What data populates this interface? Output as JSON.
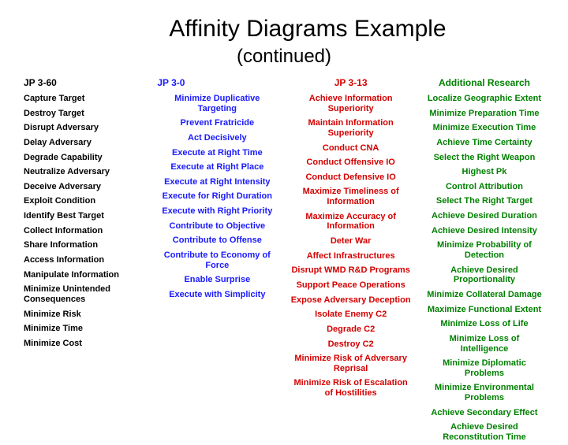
{
  "title": "Affinity Diagrams Example",
  "subtitle": "(continued)",
  "columns": [
    {
      "header": "JP 3-60",
      "color": "#000000",
      "items": [
        "Capture Target",
        "Destroy Target",
        "Disrupt Adversary",
        "Delay Adversary",
        "Degrade Capability",
        "Neutralize Adversary",
        "Deceive Adversary",
        "Exploit Condition",
        "Identify Best Target",
        "Collect Information",
        "Share Information",
        "Access Information",
        "Manipulate Information",
        "Minimize Unintended Consequences",
        "Minimize Risk",
        "Minimize Time",
        "Minimize Cost"
      ]
    },
    {
      "header": "JP 3-0",
      "color": "#1a1aff",
      "items": [
        "Minimize Duplicative Targeting",
        "Prevent Fratricide",
        "Act Decisively",
        "Execute at Right Time",
        "Execute at Right Place",
        "Execute at Right Intensity",
        "Execute for Right Duration",
        "Execute with Right Priority",
        "Contribute to Objective",
        "Contribute to Offense",
        "Contribute to Economy of Force",
        "Enable Surprise",
        "Execute with Simplicity"
      ]
    },
    {
      "header": "JP 3-13",
      "color": "#d40000",
      "items": [
        "Achieve Information Superiority",
        "Maintain Information Superiority",
        "Conduct CNA",
        "Conduct Offensive IO",
        "Conduct Defensive IO",
        "Maximize Timeliness of Information",
        "Maximize Accuracy of Information",
        "Deter War",
        "Affect Infrastructures",
        "Disrupt WMD R&D Programs",
        "Support Peace Operations",
        "Expose Adversary Deception",
        "Isolate Enemy C2",
        "Degrade C2",
        "Destroy C2",
        "Minimize Risk of Adversary Reprisal",
        "Minimize Risk of Escalation of Hostilities"
      ]
    },
    {
      "header": "Additional Research",
      "color": "#008000",
      "items": [
        "Localize Geographic Extent",
        "Minimize Preparation Time",
        "Minimize Execution Time",
        "Achieve Time Certainty",
        "Select the Right Weapon",
        "Highest Pk",
        "Control Attribution",
        "Select The Right Target",
        "Achieve Desired Duration",
        "Achieve Desired Intensity",
        "Minimize Probability of Detection",
        "Achieve Desired Proportionality",
        "Minimize Collateral Damage",
        "Maximize Functional Extent",
        "Minimize Loss of Life",
        "Minimize Loss of Intelligence",
        "Minimize Diplomatic Problems",
        "Minimize Environmental Problems",
        "Achieve Secondary Effect",
        "Achieve Desired Reconstitution Time"
      ]
    }
  ]
}
